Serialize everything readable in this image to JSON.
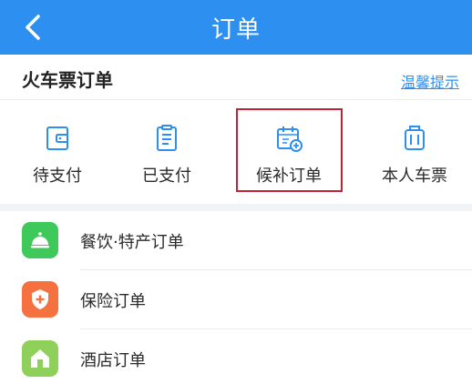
{
  "header": {
    "title": "订单",
    "back_icon": "chevron-left-icon",
    "background": "#2d8ff0"
  },
  "section": {
    "title": "火车票订单",
    "tips_link": "温馨提示"
  },
  "quick_actions": [
    {
      "label": "待支付",
      "icon": "wallet-icon"
    },
    {
      "label": "已支付",
      "icon": "receipt-icon"
    },
    {
      "label": "候补订单",
      "icon": "calendar-add-icon",
      "highlighted": true
    },
    {
      "label": "本人车票",
      "icon": "luggage-icon"
    }
  ],
  "order_list": [
    {
      "label": "餐饮·特产订单",
      "icon": "dining-bell-icon",
      "color": "#3fc95b"
    },
    {
      "label": "保险订单",
      "icon": "shield-plus-icon",
      "color": "#f5713f"
    },
    {
      "label": "酒店订单",
      "icon": "hotel-house-icon",
      "color": "#8fd05a"
    }
  ],
  "colors": {
    "accent": "#2d8ff0",
    "highlight_border": "#c62035",
    "icon_stroke": "#2d8ff0"
  }
}
